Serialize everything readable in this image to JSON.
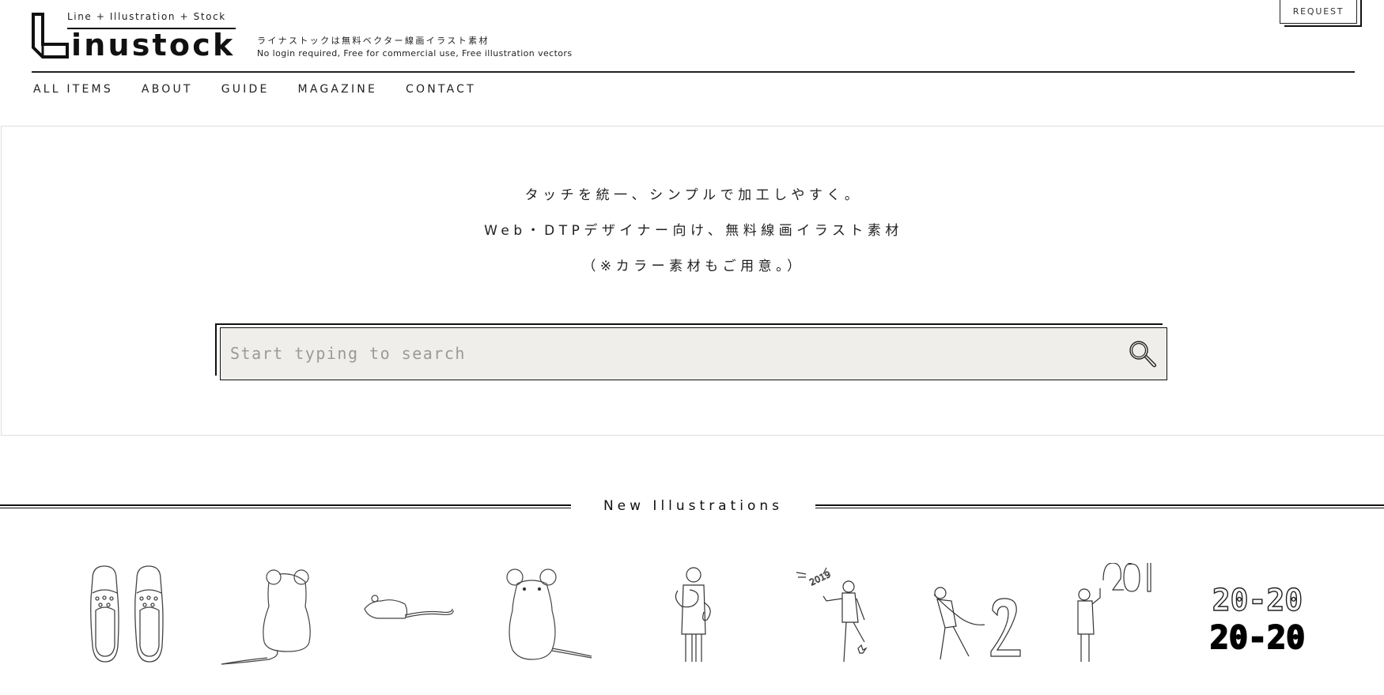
{
  "header": {
    "logo": {
      "tagline": "Line + Illustration + Stock",
      "wordmark": "inustock"
    },
    "site_tagline_ja": "ライナストックは無料ベクター線画イラスト素材",
    "site_tagline_en": "No login required, Free for commercial use, Free illustration vectors",
    "request_label": "REQUEST"
  },
  "nav": {
    "items": [
      {
        "label": "ALL ITEMS"
      },
      {
        "label": "ABOUT"
      },
      {
        "label": "GUIDE"
      },
      {
        "label": "MAGAZINE"
      },
      {
        "label": "CONTACT"
      }
    ]
  },
  "hero": {
    "line1": "タッチを統一、シンプルで加工しやすく。",
    "line2": "Web・DTPデザイナー向け、無料線画イラスト素材",
    "line3": "（※カラー素材もご用意。）",
    "search": {
      "placeholder": "Start typing to search",
      "value": "",
      "icon": "search-icon"
    }
  },
  "new_illustrations": {
    "title": "New Illustrations",
    "items": [
      {
        "subject": "pair of clog sandals"
      },
      {
        "subject": "mouse seen from behind"
      },
      {
        "subject": "mouse walking side view"
      },
      {
        "subject": "mouse standing front view"
      },
      {
        "subject": "woman holding new year lucky bag"
      },
      {
        "subject": "person kicking 2019 away"
      },
      {
        "subject": "person pulling number 2 with rope"
      },
      {
        "subject": "person waving at 201 numbers"
      },
      {
        "subject": "2020 text outline and solid",
        "text": "20-20"
      }
    ]
  }
}
